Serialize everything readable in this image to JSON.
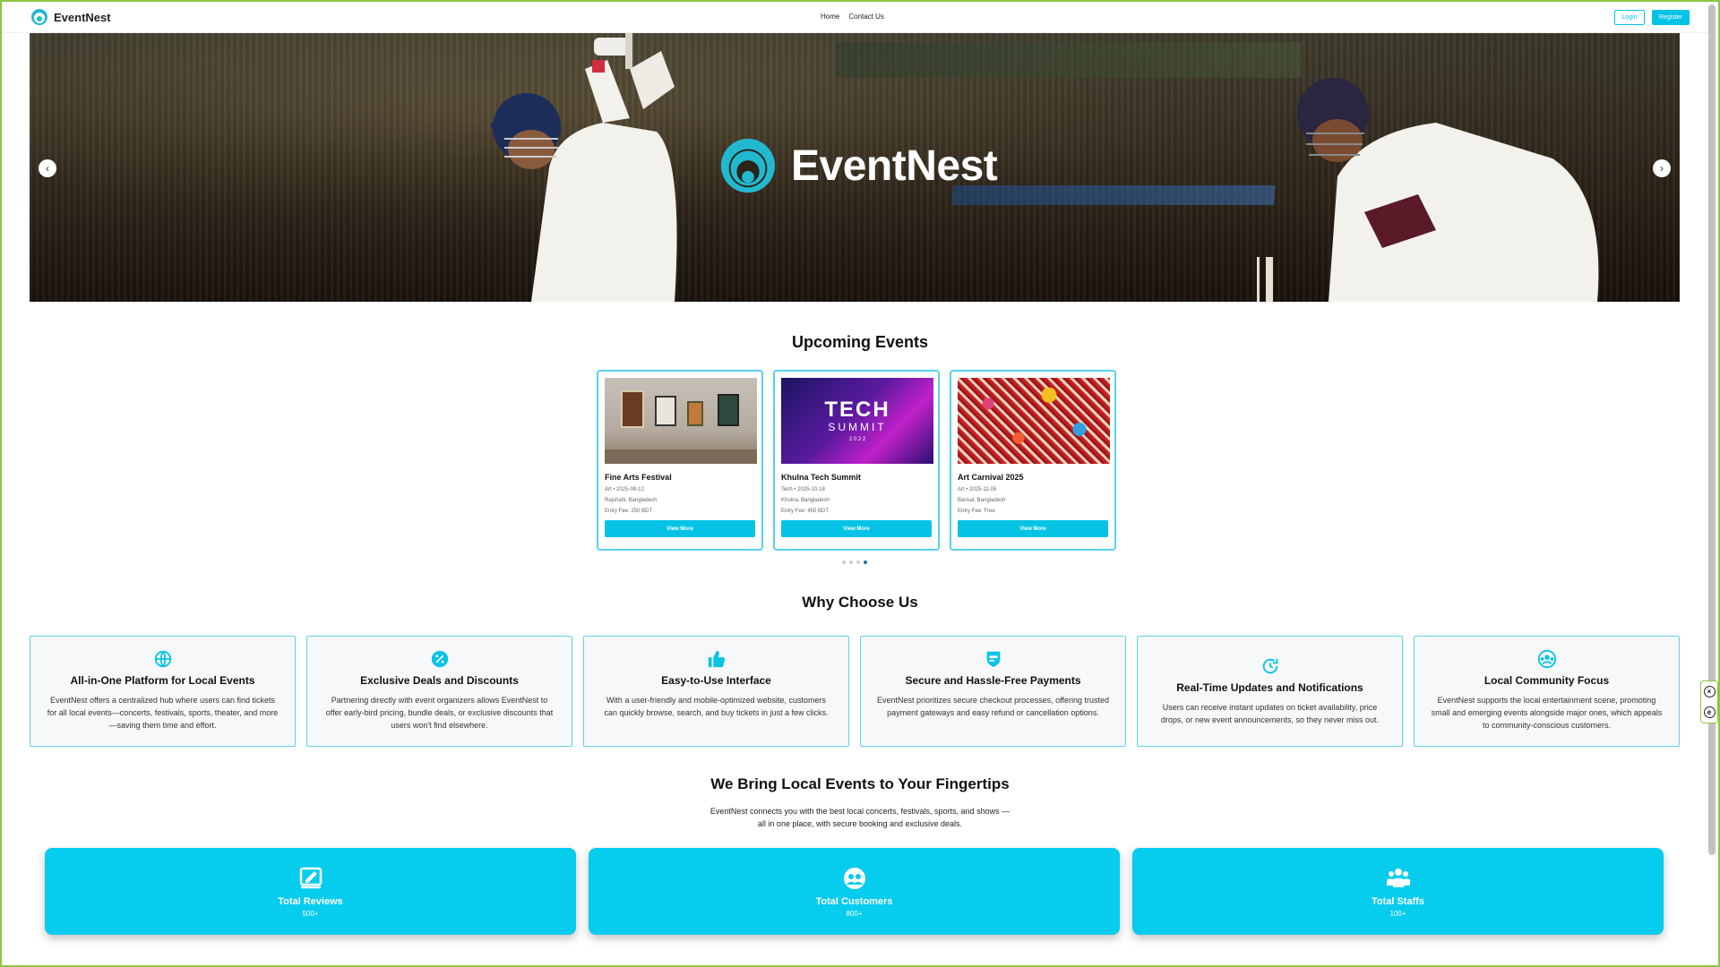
{
  "nav": {
    "brand": "EventNest",
    "links": [
      "Home",
      "Contact Us"
    ],
    "login_label": "Login",
    "register_label": "Register"
  },
  "hero": {
    "logo_text": "EventNest",
    "prev_arrow": "‹",
    "next_arrow": "›"
  },
  "upcoming": {
    "title": "Upcoming Events",
    "events": [
      {
        "name": "Fine Arts Festival",
        "category_date": "Art • 2025-09-12",
        "location": "Rajshahi, Bangladesh",
        "fee": "Entry Fee: 250 BDT",
        "button": "View More"
      },
      {
        "name": "Khulna Tech Summit",
        "category_date": "Tech • 2025-10-18",
        "location": "Khulna, Bangladesh",
        "fee": "Entry Fee: 450 BDT",
        "button": "View More",
        "banner_line1": "TECH",
        "banner_line2": "SUMMIT",
        "banner_line3": "2 0 2 2"
      },
      {
        "name": "Art Carnival 2025",
        "category_date": "Art • 2025-11-05",
        "location": "Barisal, Bangladesh",
        "fee": "Entry Fee: Free",
        "button": "View More"
      }
    ],
    "dots": 4,
    "active_dot": 3
  },
  "why": {
    "title": "Why Choose Us",
    "features": [
      {
        "icon": "globe-icon",
        "title": "All-in-One Platform for Local Events",
        "desc": "EventNest offers a centralized hub where users can find tickets for all local events—concerts, festivals, sports, theater, and more—saving them time and effort."
      },
      {
        "icon": "percent-badge-icon",
        "title": "Exclusive Deals and Discounts",
        "desc": "Partnering directly with event organizers allows EventNest to offer early-bird pricing, bundle deals, or exclusive discounts that users won't find elsewhere."
      },
      {
        "icon": "thumbs-up-icon",
        "title": "Easy-to-Use Interface",
        "desc": "With a user-friendly and mobile-optimized website, customers can quickly browse, search, and buy tickets in just a few clicks."
      },
      {
        "icon": "secure-payment-icon",
        "title": "Secure and Hassle-Free Payments",
        "desc": "EventNest prioritizes secure checkout processes, offering trusted payment gateways and easy refund or cancellation options."
      },
      {
        "icon": "refresh-clock-icon",
        "title": "Real-Time Updates and Notifications",
        "desc": "Users can receive instant updates on ticket availability, price drops, or new event announcements, so they never miss out."
      },
      {
        "icon": "community-icon",
        "title": "Local Community Focus",
        "desc": "EventNest supports the local entertainment scene, promoting small and emerging events alongside major ones, which appeals to community-conscious customers."
      }
    ]
  },
  "fingertips": {
    "title": "We Bring Local Events to Your Fingertips",
    "desc_line1": "EventNest connects you with the best local concerts, festivals, sports, and shows —",
    "desc_line2": "all in one place, with secure booking and exclusive deals.",
    "stats": [
      {
        "icon": "review-icon",
        "label": "Total Reviews",
        "value": "500+"
      },
      {
        "icon": "customers-icon",
        "label": "Total Customers",
        "value": "800+"
      },
      {
        "icon": "staff-icon",
        "label": "Total Staffs",
        "value": "100+"
      }
    ]
  },
  "colors": {
    "accent": "#06c3e6",
    "card_border": "#57d3ea",
    "window_border": "#8dc63f"
  }
}
